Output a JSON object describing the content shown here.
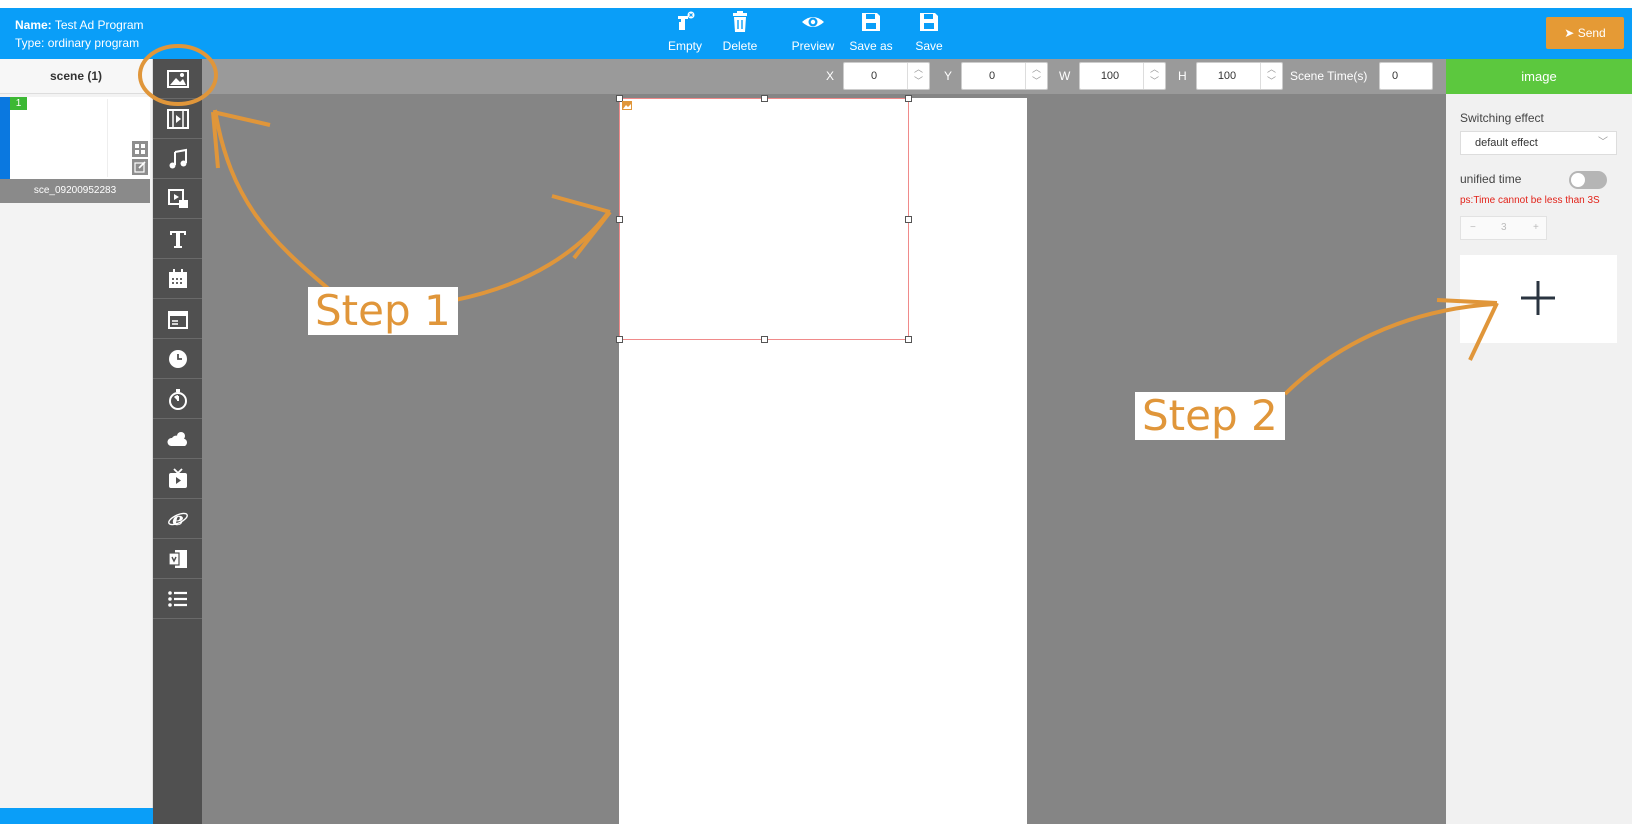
{
  "header": {
    "name_label": "Name:",
    "name_value": "Test Ad Program",
    "type_label": "Type:",
    "type_value": "ordinary program",
    "toolbar": [
      {
        "label": "Empty",
        "icon": "eraser-icon"
      },
      {
        "label": "Delete",
        "icon": "trash-icon"
      },
      {
        "label": "Preview",
        "icon": "eye-icon"
      },
      {
        "label": "Save as",
        "icon": "floppy-icon"
      },
      {
        "label": "Save",
        "icon": "floppy-icon"
      }
    ],
    "send_label": "Send"
  },
  "scene_panel": {
    "title": "scene (1)",
    "scenes": [
      {
        "number": "1",
        "name": "sce_09200952283"
      }
    ]
  },
  "toolbox": {
    "tools": [
      "image",
      "video",
      "music",
      "stream",
      "text",
      "calendar",
      "datetime",
      "clock",
      "timer",
      "weather",
      "tv",
      "web",
      "office",
      "list"
    ]
  },
  "properties": {
    "x_label": "X",
    "x_value": "0",
    "y_label": "Y",
    "y_value": "0",
    "w_label": "W",
    "w_value": "100",
    "h_label": "H",
    "h_value": "100",
    "scene_time_label": "Scene Time(s)",
    "scene_time_value": "0"
  },
  "right_panel": {
    "title": "image",
    "switching_label": "Switching effect",
    "switching_value": "default effect",
    "unified_label": "unified time",
    "unified_on": false,
    "warning": "ps:Time cannot be less than 3S",
    "stepper_value": "3",
    "stepper_minus": "−",
    "stepper_plus": "+"
  },
  "annotations": {
    "step1": "Step 1",
    "step2": "Step 2",
    "color": "#e0963a"
  },
  "colors": {
    "topbar": "#0a9ef8",
    "send": "#e59a35",
    "right_header": "#5cc83e",
    "warning": "#e2231a"
  }
}
